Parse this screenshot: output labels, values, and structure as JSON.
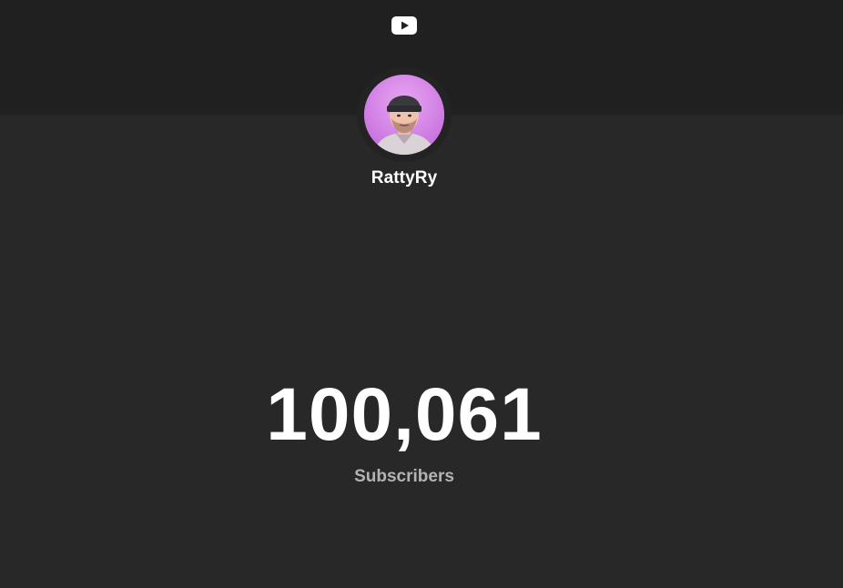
{
  "header": {
    "logo_icon": "youtube-logo-icon",
    "background_color": "#202020"
  },
  "channel": {
    "name": "RattyRy",
    "avatar_icon": "channel-avatar",
    "avatar_background": "#cf7ee6"
  },
  "stats": {
    "subscriber_count": "100,061",
    "subscriber_label": "Subscribers"
  },
  "colors": {
    "page_background": "#282828",
    "primary_text": "#ffffff",
    "secondary_text": "#b3b3b3"
  }
}
